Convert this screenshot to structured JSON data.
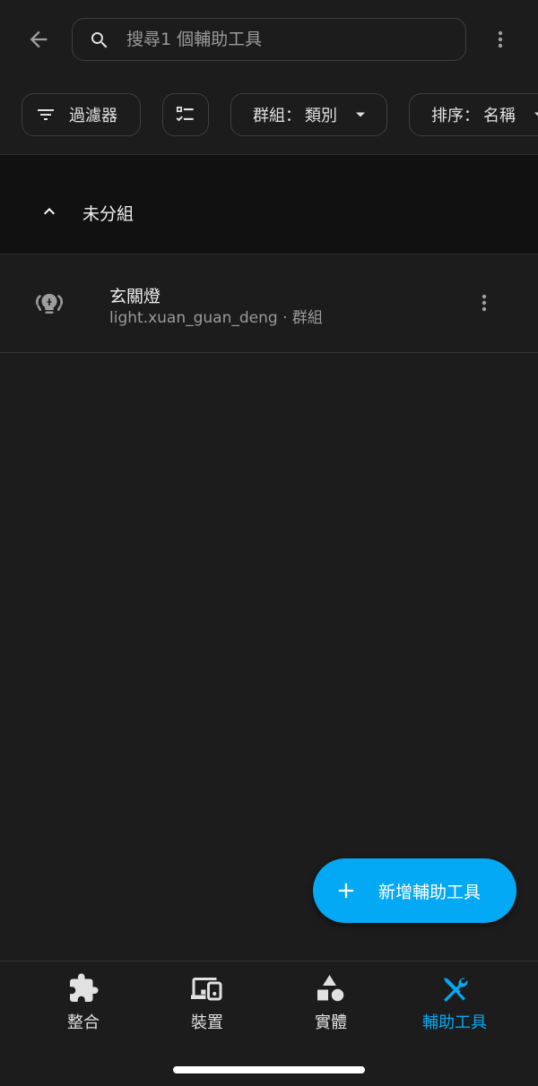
{
  "search": {
    "placeholder": "搜尋1 個輔助工具"
  },
  "filters": {
    "filter_label": "過濾器",
    "group_label": "群組：",
    "group_value": "類別",
    "sort_label": "排序：",
    "sort_value": "名稱"
  },
  "group": {
    "title": "未分組"
  },
  "items": [
    {
      "name": "玄關燈",
      "subtitle": "light.xuan_guan_deng · 群組",
      "icon": "ceiling-lights-icon"
    }
  ],
  "fab": {
    "label": "新增輔助工具"
  },
  "bottom_nav": [
    {
      "label": "整合",
      "icon": "puzzle-icon",
      "active": false
    },
    {
      "label": "裝置",
      "icon": "devices-icon",
      "active": false
    },
    {
      "label": "實體",
      "icon": "shapes-icon",
      "active": false
    },
    {
      "label": "輔助工具",
      "icon": "tools-icon",
      "active": true
    }
  ],
  "colors": {
    "accent": "#03a9f4",
    "background": "#1c1c1c",
    "group_header_bg": "#111111",
    "text": "#e1e1e1",
    "secondary_text": "#9a9a9a"
  }
}
